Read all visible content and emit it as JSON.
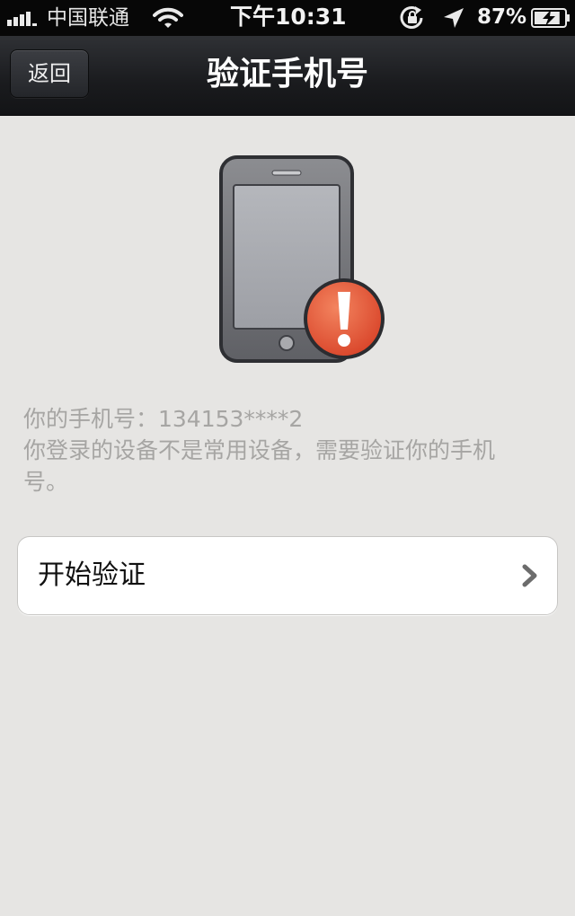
{
  "status_bar": {
    "carrier": "中国联通",
    "time": "下午10:31",
    "battery": "87%",
    "battery_level": 0.87,
    "icons": [
      "signal-icon",
      "wifi-icon",
      "rotation-lock-icon",
      "location-arrow-icon",
      "battery-charging-icon"
    ]
  },
  "nav": {
    "back_label": "返回",
    "title": "验证手机号"
  },
  "hero": {
    "icons": [
      "phone-icon",
      "warning-badge-icon"
    ]
  },
  "info": {
    "phone_line": "你的手机号：134153****2",
    "message_line1": "你登录的设备不是常用设备，需要验证你的手机",
    "message_line2": "号。"
  },
  "action": {
    "label": "开始验证",
    "icon": "chevron-right-icon"
  },
  "colors": {
    "status_bar_bg": "#070707",
    "nav_bg": "#1a1b1e",
    "page_bg": "#e6e5e3",
    "warning": "#e4553a",
    "info_text": "#a6a5a3"
  }
}
